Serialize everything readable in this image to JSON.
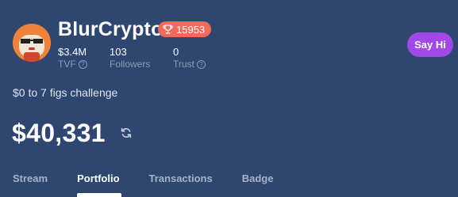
{
  "profile": {
    "username": "BlurCrypto",
    "badge_icon": "trophy-icon",
    "badge_value": "15953",
    "bio": "$0 to 7 figs challenge",
    "value": "$40,331"
  },
  "stats": {
    "tvf_value": "$3.4M",
    "tvf_label": "TVF",
    "followers_value": "103",
    "followers_label": "Followers",
    "trust_value": "0",
    "trust_label": "Trust",
    "help_glyph": "?"
  },
  "actions": {
    "say_hi_label": "Say Hi"
  },
  "tabs": [
    {
      "label": "Stream"
    },
    {
      "label": "Portfolio"
    },
    {
      "label": "Transactions"
    },
    {
      "label": "Badge"
    }
  ],
  "active_tab": "Portfolio",
  "colors": {
    "background": "#2f4670",
    "badge": "#f26a5c",
    "say_hi": "#a348e8",
    "avatar": "#f0823a"
  }
}
